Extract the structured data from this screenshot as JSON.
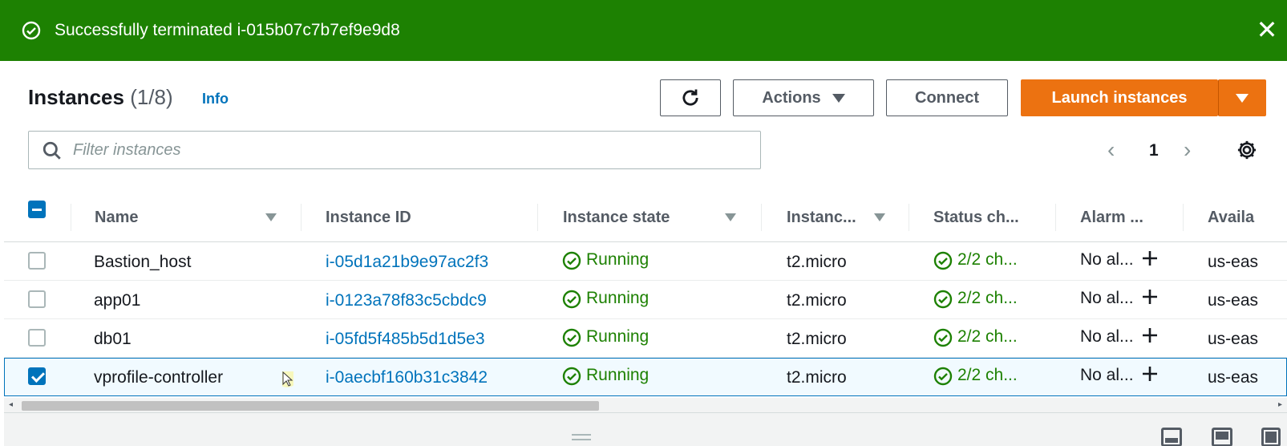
{
  "flash": {
    "message": "Successfully terminated i-015b07c7b7ef9e9d8",
    "close": "✕",
    "color": "#1d8102"
  },
  "header": {
    "title": "Instances",
    "count": "(1/8)",
    "info": "Info"
  },
  "toolbar": {
    "actions_label": "Actions",
    "connect_label": "Connect",
    "launch_label": "Launch instances"
  },
  "filter": {
    "placeholder": "Filter instances",
    "value": ""
  },
  "pagination": {
    "prev": "‹",
    "page": "1",
    "next": "›"
  },
  "table": {
    "columns": [
      "Name",
      "Instance ID",
      "Instance state",
      "Instanc...",
      "Status ch...",
      "Alarm ...",
      "Availa"
    ],
    "rows": [
      {
        "name": "Bastion_host",
        "id": "i-05d1a21b9e97ac2f3",
        "state": "Running",
        "type": "t2.micro",
        "status": "2/2 ch...",
        "alarm": "No al...",
        "az": "us-eas",
        "selected": false
      },
      {
        "name": "app01",
        "id": "i-0123a78f83c5cbdc9",
        "state": "Running",
        "type": "t2.micro",
        "status": "2/2 ch...",
        "alarm": "No al...",
        "az": "us-eas",
        "selected": false
      },
      {
        "name": "db01",
        "id": "i-05fd5f485b5d1d5e3",
        "state": "Running",
        "type": "t2.micro",
        "status": "2/2 ch...",
        "alarm": "No al...",
        "az": "us-eas",
        "selected": false
      },
      {
        "name": "vprofile-controller",
        "id": "i-0aecbf160b31c3842",
        "state": "Running",
        "type": "t2.micro",
        "status": "2/2 ch...",
        "alarm": "No al...",
        "az": "us-eas",
        "selected": true
      }
    ]
  },
  "colors": {
    "accent": "#ec7211",
    "link": "#0073bb",
    "success": "#1d8102"
  },
  "icons": [
    "check-circle-icon",
    "close-icon",
    "refresh-icon",
    "caret-down-icon",
    "search-icon",
    "chevron-left-icon",
    "chevron-right-icon",
    "gear-icon",
    "sort-icon",
    "plus-icon",
    "drag-handle-icon",
    "layout-icon"
  ]
}
